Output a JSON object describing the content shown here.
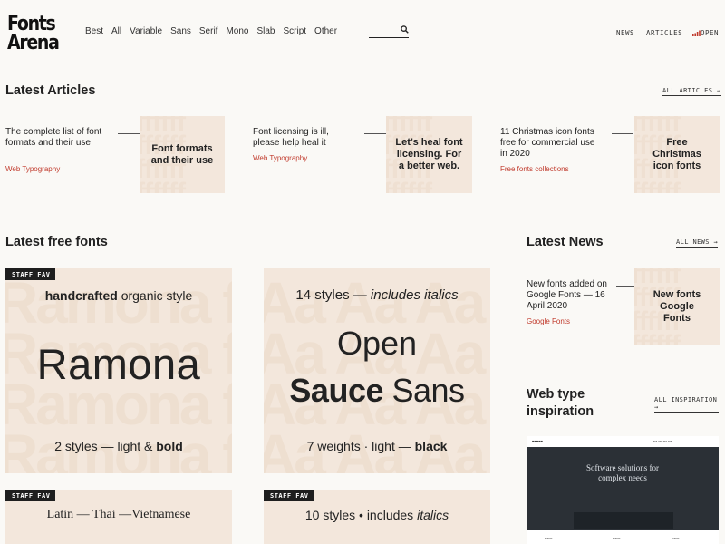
{
  "header": {
    "logo_line1": "Fonts",
    "logo_line2": "Arena",
    "nav": [
      "Best",
      "All",
      "Variable",
      "Sans",
      "Serif",
      "Mono",
      "Slab",
      "Script",
      "Other"
    ],
    "right": {
      "news": "NEWS",
      "articles": "ARTICLES",
      "open": "OPEN"
    }
  },
  "latest_articles": {
    "title": "Latest Articles",
    "all_link": "ALL ARTICLES →",
    "items": [
      {
        "title": "The complete list of font formats and their use",
        "category": "Web Typography",
        "thumb": "Font formats and their use"
      },
      {
        "title": "Font licensing is ill, please help heal it",
        "category": "Web Typography",
        "thumb": "Let’s heal font licensing. For a better web."
      },
      {
        "title": "11 Christmas icon fonts free for commercial use in 2020",
        "category": "Free fonts collections",
        "thumb": "Free Christmas icon fonts"
      }
    ]
  },
  "latest_free_fonts": {
    "title": "Latest free fonts",
    "cards": [
      {
        "badge": "STAFF FAV",
        "top_bold": "handcrafted",
        "top_rest": " organic style",
        "name": "Ramona",
        "bottom_pre": "2 styles — light & ",
        "bottom_bold": "bold"
      },
      {
        "top_pre": "14 styles — ",
        "top_italic": "includes italics",
        "name_line1": "Open",
        "name_bold": "Sauce",
        "name_rest": " Sans",
        "bottom_pre": "7 weights · light — ",
        "bottom_bold": "black"
      },
      {
        "badge": "STAFF FAV",
        "top": "Latin — Thai —Vietnamese"
      },
      {
        "badge": "STAFF FAV",
        "top_pre": "10 styles • includes ",
        "top_italic": "italics"
      }
    ]
  },
  "latest_news": {
    "title": "Latest News",
    "all_link": "ALL NEWS →",
    "item": {
      "title": "New fonts added on Google Fonts — 16 April 2020",
      "category": "Google Fonts",
      "thumb": "New fonts Google Fonts"
    }
  },
  "inspiration": {
    "title_line1": "Web type",
    "title_line2": "inspiration",
    "all_link": "ALL INSPIRATION →",
    "hero_line1": "Software solutions for",
    "hero_line2": "complex needs"
  },
  "colors": {
    "background": "#faf9f6",
    "card": "#f3e7dc",
    "accent": "#c0392b",
    "badge": "#1e1e1e"
  },
  "icons": {
    "search": "search-icon",
    "open": "signal-bars-icon"
  }
}
